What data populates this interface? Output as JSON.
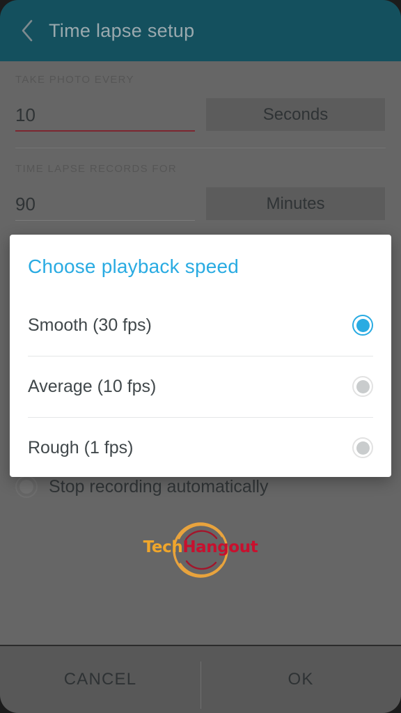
{
  "header": {
    "back_icon": "chevron-left-icon",
    "title": "Time lapse setup",
    "bg_color": "#14505e",
    "title_color": "#9aa9ae"
  },
  "form": {
    "interval": {
      "label": "TAKE PHOTO EVERY",
      "value": "10",
      "placeholder": "0",
      "unit": "Seconds",
      "underline_color": "#7d2630"
    },
    "duration": {
      "label": "TIME LAPSE RECORDS FOR",
      "value": "90",
      "placeholder": "0",
      "unit": "Minutes",
      "underline_color": "#7b7b7b"
    },
    "stop_recording": {
      "label": "Stop recording automatically",
      "checked": false
    }
  },
  "logo": {
    "text_part1": "Tech",
    "text_part2": "Hangout",
    "part1_color": "#f0a62b",
    "part2_color": "#c8102e",
    "ring_color": "#e8a33d",
    "arc_color": "#a3152b"
  },
  "dialog": {
    "title": "Choose playback speed",
    "title_color": "#29abe2",
    "accent_color": "#29abe2",
    "options": [
      {
        "label": "Smooth (30 fps)",
        "selected": true
      },
      {
        "label": "Average (10 fps)",
        "selected": false
      },
      {
        "label": "Rough (1 fps)",
        "selected": false
      }
    ]
  },
  "actions": {
    "cancel_label": "CANCEL",
    "ok_label": "OK"
  }
}
